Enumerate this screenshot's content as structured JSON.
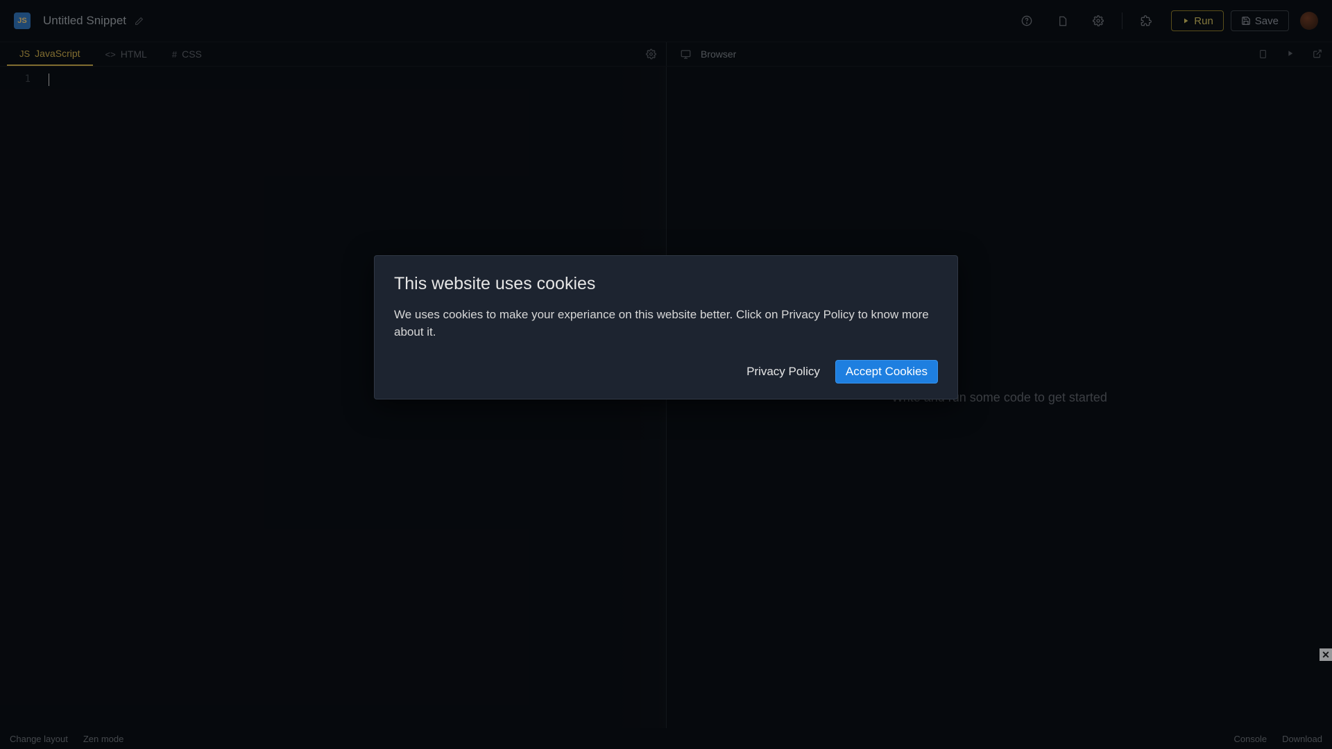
{
  "header": {
    "logo_text": "JS",
    "title": "Untitled Snippet",
    "run_label": "Run",
    "save_label": "Save"
  },
  "tabs": {
    "editor": [
      {
        "label": "JavaScript",
        "icon": "JS",
        "active": true
      },
      {
        "label": "HTML",
        "icon": "<>",
        "active": false
      },
      {
        "label": "CSS",
        "icon": "#",
        "active": false
      }
    ],
    "preview_label": "Browser"
  },
  "editor": {
    "line_number": "1"
  },
  "preview": {
    "placeholder": "Write and run some code to get started"
  },
  "footer": {
    "change_layout": "Change layout",
    "zen_mode": "Zen mode",
    "console": "Console",
    "download": "Download"
  },
  "modal": {
    "title": "This website uses cookies",
    "body": "We uses cookies to make your experiance on this website better. Click on Privacy Policy to know more about it.",
    "privacy_label": "Privacy Policy",
    "accept_label": "Accept Cookies"
  }
}
